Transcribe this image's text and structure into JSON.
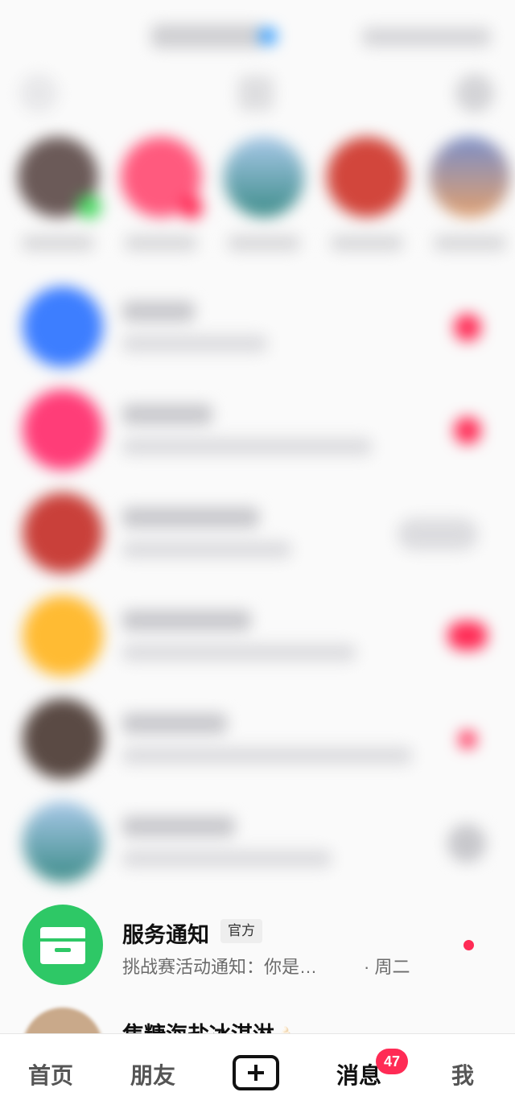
{
  "colors": {
    "accent": "#ff2b55",
    "service_green": "#2ec866",
    "background": "#fafafa"
  },
  "service_notice": {
    "title": "服务通知",
    "badge": "官方",
    "preview": "挑战赛活动通知：你是…",
    "time": "· 周二",
    "icon": "inbox-icon"
  },
  "next_chat": {
    "title": "焦糖海盐冰淇淋",
    "emoji": "🍦"
  },
  "tabbar": {
    "home": "首页",
    "friends": "朋友",
    "create_icon": "plus-icon",
    "messages": "消息",
    "messages_badge": "47",
    "me": "我"
  }
}
